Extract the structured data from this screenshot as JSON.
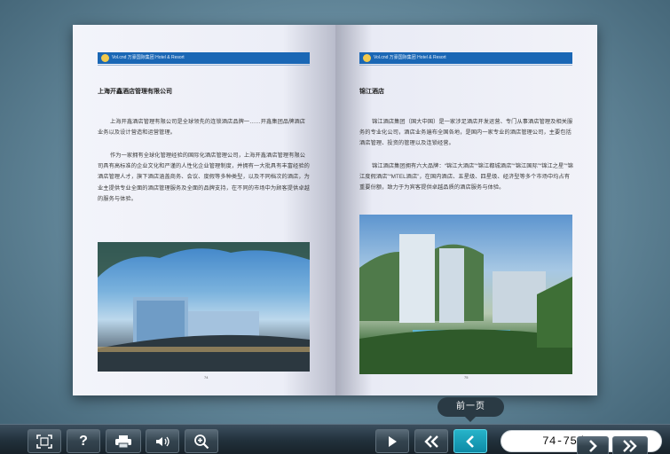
{
  "left_page": {
    "header_text": "Vol.cnd 万豪国际集团 Hotel & Resort",
    "title": "上海开鑫酒店管理有限公司",
    "paragraphs": [
      "上海开鑫酒店管理有限公司是全球领先的连锁酒店品牌一……开鑫集团品牌酒店业务以及设计营造和运营管理。",
      "作为一家拥有全球化管理经验的国际化酒店管理公司，上海开鑫酒店管理有限公司具有高标准的企业文化和严谨的人性化企业管理制度，并拥有一大批具有丰富经验的酒店管理人才，旗下酒店涵盖商务、会议、度假等多种类型，以及不同档次的酒店，为业主提供专业全面的酒店管理服务及全面的品牌支持，在不同的市场中为顾客提供卓越的服务与体验。"
    ],
    "page_number": "74"
  },
  "right_page": {
    "header_text": "Vol.cnd 万豪国际集团 Hotel & Resort",
    "title": "锦江酒店",
    "paragraphs": [
      "锦江酒店集团（国大中国）是一家涉足酒店开发运营、专门从事酒店管理及相关服务的专业化公司，酒店业务遍布全国各地，是国内一家专业的酒店管理公司，主要包括酒店管理、投资的管理以及连锁经营。",
      "锦江酒店集团拥有六大品牌：“锦江大酒店”“锦江都城酒店”“锦江国际”“锦江之星”“锦江度假酒店”“MTEL酒店”，在国内酒店、五星级、四星级、经济型等多个市场中均占有重要份额，致力于为宾客提供卓越品质的酒店服务与体验。"
    ],
    "page_number": "75"
  },
  "toolbar": {
    "tooltip": "前一页",
    "page_field_value": "74-75/78",
    "buttons": {
      "fullscreen": "fullscreen-icon",
      "help": "?",
      "print": "print-icon",
      "sound": "speaker-icon",
      "zoom": "zoom-in-icon",
      "play": "play-icon",
      "first": "double-left-icon",
      "prev": "chevron-left-icon",
      "next": "chevron-right-icon",
      "last": "double-right-icon"
    }
  },
  "colors": {
    "background": "#6a8fa2",
    "toolbar": "#21303b",
    "accent_active": "#0e8aa6",
    "header_bar": "#1a67b5"
  }
}
